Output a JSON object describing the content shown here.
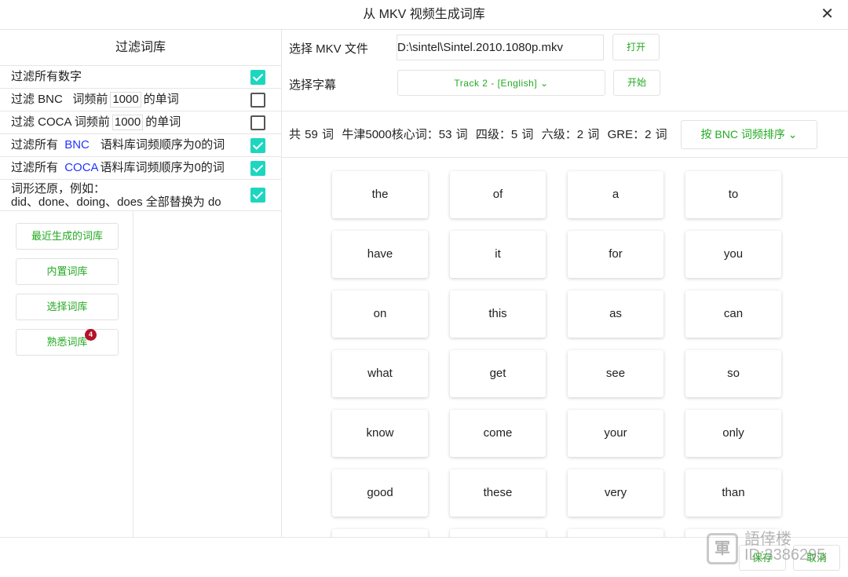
{
  "window": {
    "title": "从 MKV 视频生成词库",
    "close_icon": "close-icon"
  },
  "left": {
    "header": "过滤词库",
    "filters": [
      {
        "label": "过滤所有数字",
        "checked": true
      },
      {
        "pre": "过滤 BNC   词频前",
        "value": "1000",
        "post": "的单词",
        "checked": false
      },
      {
        "pre": "过滤 COCA 词频前",
        "value": "1000",
        "post": "的单词",
        "checked": false
      },
      {
        "pre": "过滤所有",
        "corpus": "BNC",
        "post": "语料库词频顺序为0的词",
        "checked": true
      },
      {
        "pre": "过滤所有",
        "corpus": "COCA",
        "post": "语料库词频顺序为0的词",
        "checked": true
      },
      {
        "line1": "词形还原，例如：",
        "line2": "did、done、doing、does 全部替换为 do",
        "checked": true
      }
    ],
    "buttons": [
      "最近生成的词库",
      "内置词库",
      "选择词库",
      "熟悉词库"
    ],
    "badge": "4"
  },
  "right": {
    "file_label": "选择 MKV 文件",
    "file_value": "D:\\sintel\\Sintel.2010.1080p.mkv",
    "open": "打开",
    "subtitle_label": "选择字幕",
    "subtitle_value": "Track 2 - [English]",
    "start": "开始",
    "stats": "共 59 词  牛津5000核心词：53 词  四级：5 词  六级：2 词  GRE：2 词",
    "sort": "按 BNC 词频排序",
    "words": [
      "the",
      "of",
      "a",
      "to",
      "have",
      "it",
      "for",
      "you",
      "on",
      "this",
      "as",
      "can",
      "what",
      "get",
      "see",
      "so",
      "know",
      "come",
      "your",
      "only",
      "good",
      "these",
      "very",
      "than",
      "",
      "",
      "",
      ""
    ]
  },
  "footer": {
    "save": "保存",
    "cancel": "取消"
  },
  "watermark": {
    "line1": "語倖楼",
    "line2": "ID:3386295"
  },
  "colors": {
    "accent": "#22aa22",
    "checkbox": "#1dd6c0",
    "corpus": "#2233ff",
    "badge": "#b5122a"
  }
}
